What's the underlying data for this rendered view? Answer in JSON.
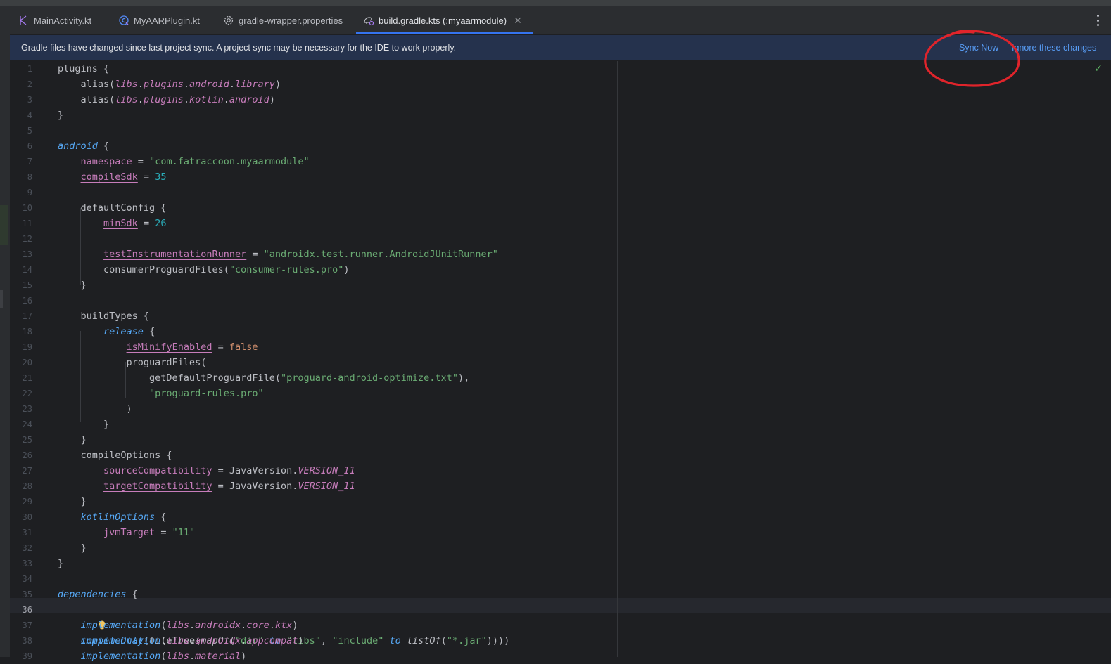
{
  "tabs": [
    {
      "label": "MainActivity.kt",
      "icon": "kotlin-file-icon"
    },
    {
      "label": "MyAARPlugin.kt",
      "icon": "kotlin-class-icon"
    },
    {
      "label": "gradle-wrapper.properties",
      "icon": "gear-icon"
    },
    {
      "label": "build.gradle.kts (:myaarmodule)",
      "icon": "gradle-kts-icon",
      "active": true
    }
  ],
  "banner": {
    "message": "Gradle files have changed since last project sync. A project sync may be necessary for the IDE to work properly.",
    "sync_now": "Sync Now",
    "ignore": "Ignore these changes"
  },
  "editor": {
    "current_line": 36,
    "line_numbers": [
      "1",
      "2",
      "3",
      "4",
      "5",
      "6",
      "7",
      "8",
      "9",
      "10",
      "11",
      "12",
      "13",
      "14",
      "15",
      "16",
      "17",
      "18",
      "19",
      "20",
      "21",
      "22",
      "23",
      "24",
      "25",
      "26",
      "27",
      "28",
      "29",
      "30",
      "31",
      "32",
      "33",
      "34",
      "35",
      "36",
      "37",
      "38",
      "39"
    ]
  },
  "colors": {
    "accent": "#3574f0",
    "annotation": "#e0242b",
    "background": "#1e1f22",
    "banner": "#25324d",
    "link": "#589df6"
  }
}
